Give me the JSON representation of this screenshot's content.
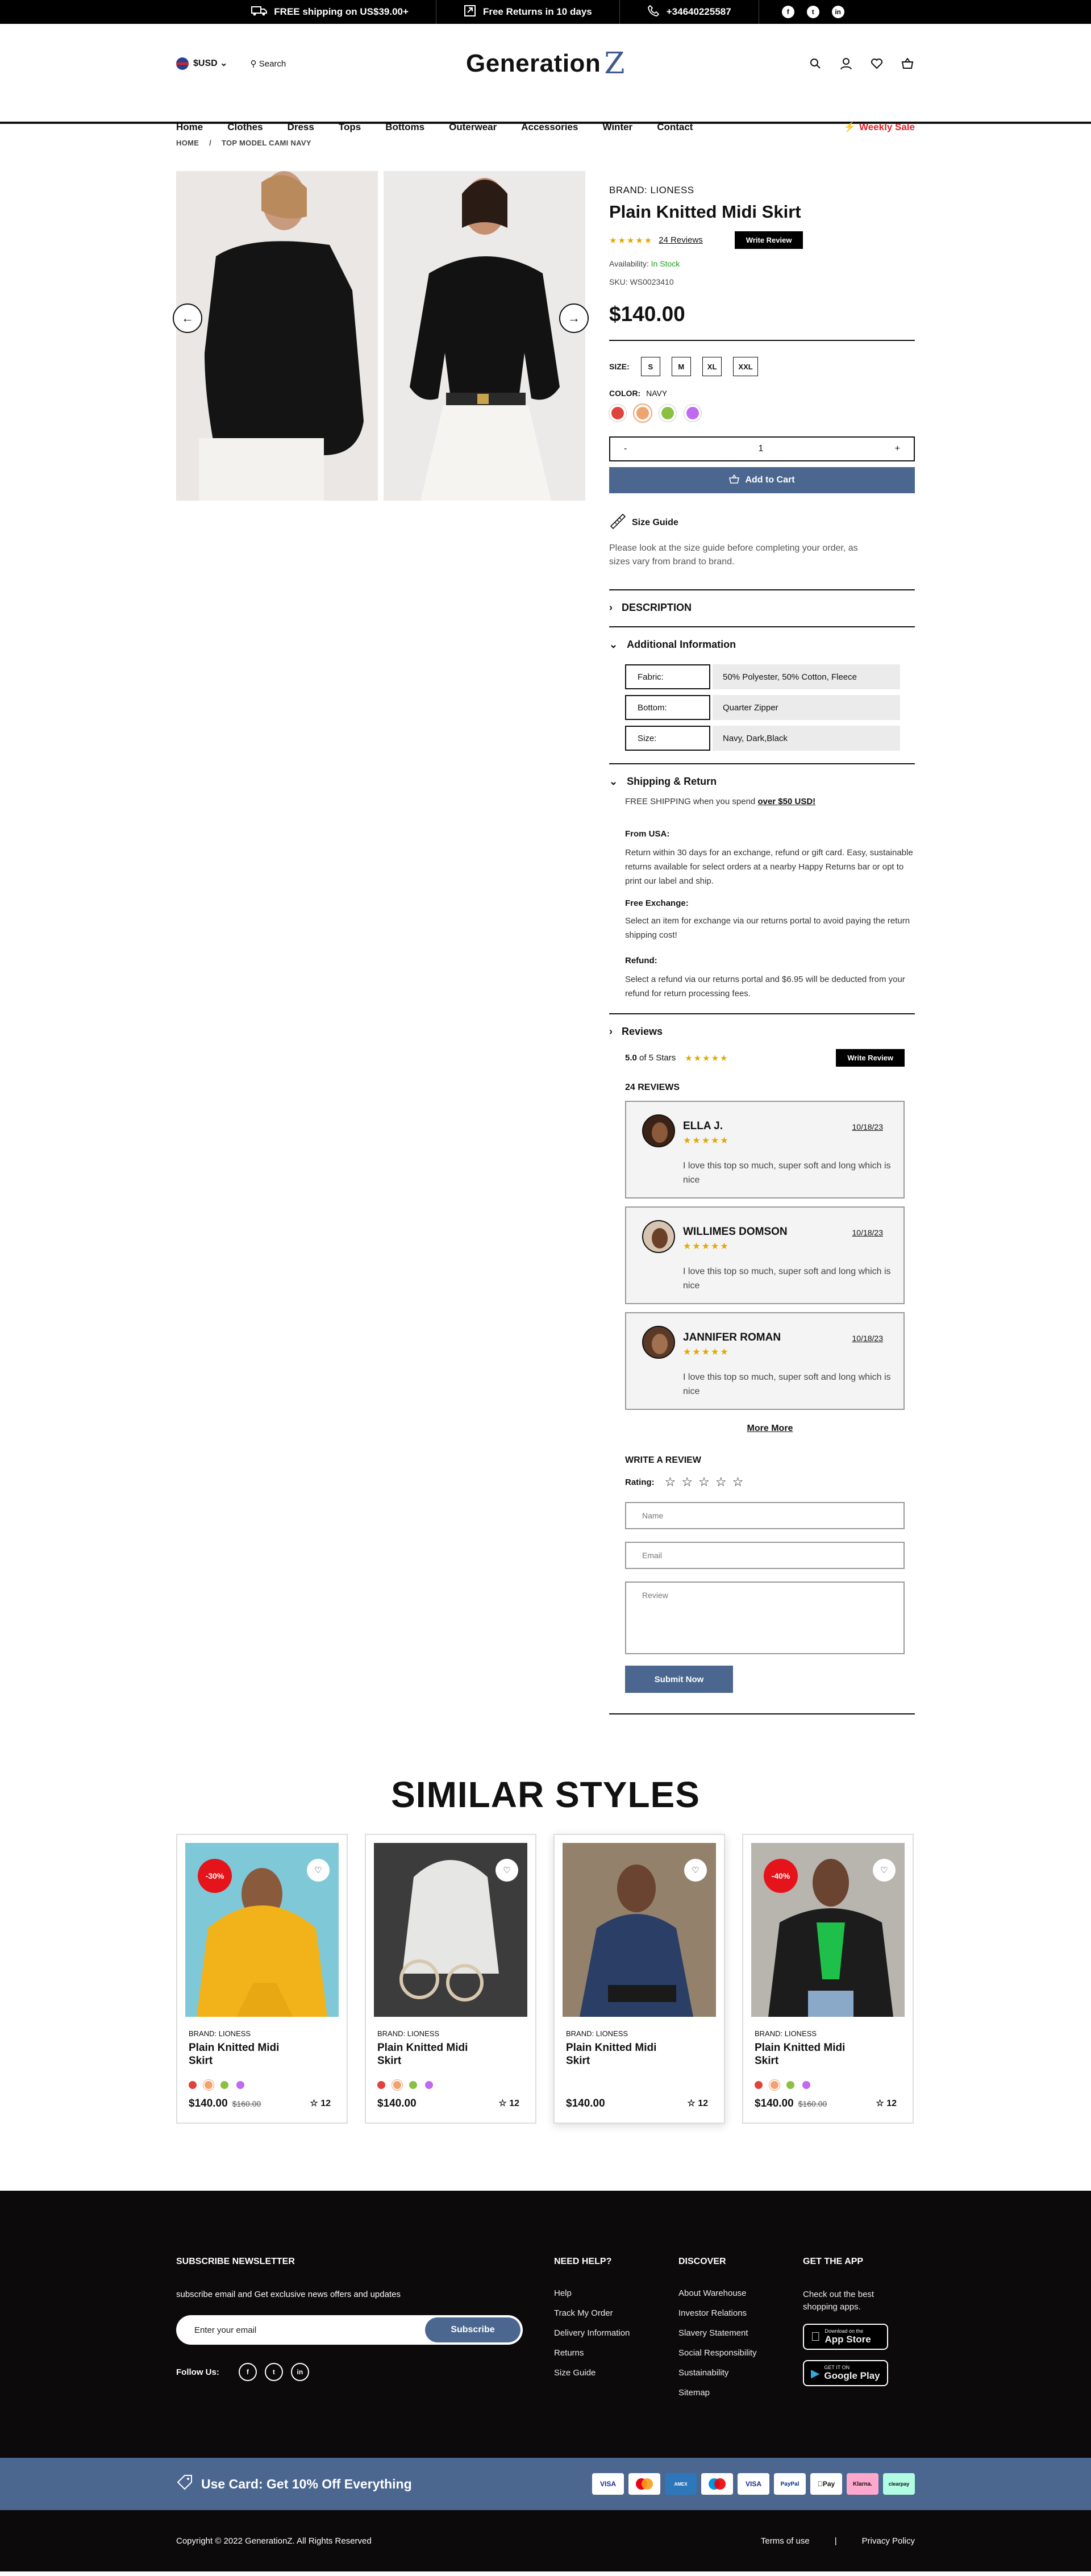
{
  "topbar": {
    "shipping": "FREE shipping on US$39.00+",
    "returns": "Free Returns in 10 days",
    "phone": "+34640225587"
  },
  "header": {
    "currency": "$USD",
    "search_label": "Search",
    "logo_text": "Generation",
    "logo_mark": "Z",
    "nav": [
      "Home",
      "Clothes",
      "Dress",
      "Tops",
      "Bottoms",
      "Outerwear",
      "Accessories",
      "Winter",
      "Contact"
    ],
    "sale_label": "Weekly Sale"
  },
  "breadcrumb": [
    "HOME",
    "/",
    "TOP MODEL CAMI NAVY"
  ],
  "product": {
    "brand": "BRAND: LIONESS",
    "title": "Plain Knitted Midi Skirt",
    "reviews_count_label": "24 Reviews",
    "write_review": "Write Review",
    "availability_label": "Availability:",
    "availability_value": "In Stock",
    "sku": "SKU: WS0023410",
    "price": "$140.00",
    "size_label": "SIZE:",
    "sizes": [
      "S",
      "M",
      "XL",
      "XXL"
    ],
    "color_label": "COLOR:",
    "color_value": "NAVY",
    "colors": [
      "#e0423c",
      "#f0a36f",
      "#8cc043",
      "#c06bef"
    ],
    "qty_minus": "-",
    "qty_value": "1",
    "qty_plus": "+",
    "add_to_cart": "Add to Cart",
    "size_guide": "Size Guide",
    "size_guide_text": "Please look at the size guide before completing your order, as sizes vary from brand to brand."
  },
  "description": {
    "heading": "DESCRIPTION"
  },
  "additional": {
    "heading": "Additional Information",
    "rows": [
      {
        "k": "Fabric:",
        "v": "50% Polyester, 50% Cotton, Fleece"
      },
      {
        "k": "Bottom:",
        "v": "Quarter Zipper"
      },
      {
        "k": "Size:",
        "v": "Navy, Dark,Black"
      }
    ]
  },
  "shipping": {
    "heading": "Shipping & Return",
    "free_text": "FREE SHIPPING when you spend",
    "free_link": "over $50 USD!",
    "from_usa_h": "From USA:",
    "from_usa": "Return within 30 days for an exchange, refund or gift card. Easy, sustainable returns available for select orders at a nearby Happy Returns bar or opt to print our label and ship.",
    "exchange_h": "Free Exchange:",
    "exchange": "Select an item for exchange via our returns portal to avoid paying the return shipping cost!",
    "refund_h": "Refund:",
    "refund": "Select a refund via our returns portal and $6.95 will be deducted from your refund for return processing fees."
  },
  "reviews": {
    "heading": "Reviews",
    "score": "5.0",
    "score_suffix": "of 5 Stars",
    "write_review": "Write Review",
    "count_label": "24 REVIEWS",
    "items": [
      {
        "name": "ELLA J.",
        "date": "10/18/23",
        "text": "I love this top so much, super soft and long which is nice"
      },
      {
        "name": "WILLIMES DOMSON",
        "date": "10/18/23",
        "text": "I love this top so much, super soft and long which is nice"
      },
      {
        "name": "JANNIFER ROMAN",
        "date": "10/18/23",
        "text": "I love this top so much, super soft and long which is nice"
      }
    ],
    "more": "More More",
    "write_heading": "WRITE A REVIEW",
    "rating_label": "Rating:",
    "name_placeholder": "Name",
    "email_placeholder": "Email",
    "review_placeholder": "Review",
    "submit": "Submit Now"
  },
  "similar": {
    "heading": "SIMILAR STYLES",
    "cards": [
      {
        "discount": "-30%",
        "brand": "BRAND: LIONESS",
        "title": "Plain Knitted Midi Skirt",
        "price": "$140.00",
        "old": "$160.00",
        "rating": "12"
      },
      {
        "discount": "",
        "brand": "BRAND: LIONESS",
        "title": "Plain Knitted Midi Skirt",
        "price": "$140.00",
        "old": "",
        "rating": "12"
      },
      {
        "discount": "",
        "brand": "BRAND: LIONESS",
        "title": "Plain Knitted Midi Skirt",
        "price": "$140.00",
        "old": "",
        "rating": "12"
      },
      {
        "discount": "-40%",
        "brand": "BRAND: LIONESS",
        "title": "Plain Knitted Midi Skirt",
        "price": "$140.00",
        "old": "$160.00",
        "rating": "12"
      }
    ]
  },
  "footer": {
    "newsletter_h": "SUBSCRIBE NEWSLETTER",
    "newsletter_text": "subscribe email and Get exclusive news offers and updates",
    "email_placeholder": "Enter your email",
    "subscribe": "Subscribe",
    "follow": "Follow Us:",
    "help_h": "NEED HELP?",
    "help": [
      "Help",
      "Track My Order",
      "Delivery Information",
      "Returns",
      "Size Guide"
    ],
    "discover_h": "DISCOVER",
    "discover": [
      "About Warehouse",
      "Investor Relations",
      "Slavery Statement",
      "Social Responsibility",
      "Sustainability",
      "Sitemap"
    ],
    "app_h": "GET THE APP",
    "app_text": "Check out the best shopping apps.",
    "appstore_small": "Download on the",
    "appstore": "App Store",
    "gplay_small": "GET IT ON",
    "gplay": "Google Play"
  },
  "promo": {
    "text": "Use Card:  Get 10% Off Everything",
    "payments": [
      "VISA",
      "MC",
      "AMEX",
      "Maestro",
      "VISA",
      "PayPal",
      "Pay",
      "Klarna.",
      "clearpay"
    ]
  },
  "bottom": {
    "copyright": "Copyright © 2022 GenerationZ. All Rights Reserved",
    "terms": "Terms of use",
    "sep": "|",
    "privacy": "Privacy Policy"
  }
}
